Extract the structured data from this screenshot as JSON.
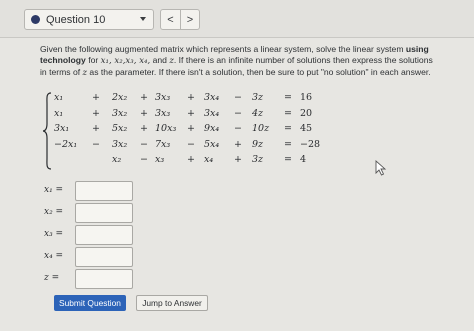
{
  "header": {
    "question_label": "Question 10",
    "prev_icon": "chevron-left-icon",
    "next_icon": "chevron-right-icon",
    "prev_glyph": "<",
    "next_glyph": ">"
  },
  "prompt": {
    "line1": "Given the following augmented matrix which represents a linear system, solve the linear system ",
    "line1_bold": "using",
    "line2_bold": "technology",
    "line2_a": " for ",
    "line2_vars": "x₁, x₂,x₃, x₄,",
    "line2_b": " and ",
    "line2_z": "z",
    "line2_c": ". If there is an infinite number of solutions then express the solutions",
    "line3_a": "in terms of ",
    "line3_z": "z",
    "line3_b": " as the parameter. If there isn't a solution, then be sure to put \"no solution\" in each answer."
  },
  "system": {
    "rows": [
      [
        "x₁",
        "+",
        "2x₂",
        "+",
        "3x₃",
        "+",
        "3x₄",
        "−",
        "3z",
        "=",
        "16"
      ],
      [
        "x₁",
        "+",
        "3x₂",
        "+",
        "3x₃",
        "+",
        "3x₄",
        "−",
        "4z",
        "=",
        "20"
      ],
      [
        "3x₁",
        "+",
        "5x₂",
        "+",
        "10x₃",
        "+",
        "9x₄",
        "−",
        "10z",
        "=",
        "45"
      ],
      [
        "−2x₁",
        "−",
        "3x₂",
        "−",
        "7x₃",
        "−",
        "5x₄",
        "+",
        "9z",
        "=",
        "−28"
      ],
      [
        "",
        "",
        "x₂",
        "−",
        "x₃",
        "+",
        "x₄",
        "+",
        "3z",
        "=",
        "4"
      ]
    ]
  },
  "answers": [
    {
      "label": "x₁ =",
      "value": ""
    },
    {
      "label": "x₂ =",
      "value": ""
    },
    {
      "label": "x₃ =",
      "value": ""
    },
    {
      "label": "x₄ =",
      "value": ""
    },
    {
      "label": "z =",
      "value": ""
    }
  ],
  "buttons": {
    "submit": "Submit Question",
    "jump": "Jump to Answer"
  },
  "colors": {
    "accent": "#2c63b8",
    "dot": "#2d3a66"
  }
}
